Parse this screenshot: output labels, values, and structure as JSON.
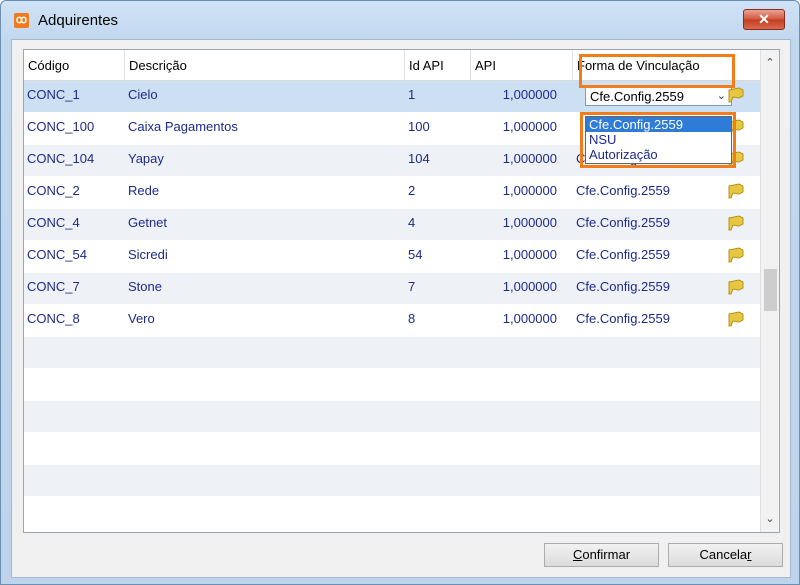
{
  "window": {
    "title": "Adquirentes",
    "close_label": "✕"
  },
  "columns": [
    "Código",
    "Descrição",
    "Id API",
    "API",
    "Forma de Vinculação"
  ],
  "rows": [
    {
      "codigo": "CONC_1",
      "descricao": "Cielo",
      "id_api": "1",
      "api": "1,000000",
      "forma": "Cfe.Config.2559"
    },
    {
      "codigo": "CONC_100",
      "descricao": "Caixa Pagamentos",
      "id_api": "100",
      "api": "1,000000",
      "forma": ""
    },
    {
      "codigo": "CONC_104",
      "descricao": "Yapay",
      "id_api": "104",
      "api": "1,000000",
      "forma": "Cfe.Config.2559"
    },
    {
      "codigo": "CONC_2",
      "descricao": "Rede",
      "id_api": "2",
      "api": "1,000000",
      "forma": "Cfe.Config.2559"
    },
    {
      "codigo": "CONC_4",
      "descricao": "Getnet",
      "id_api": "4",
      "api": "1,000000",
      "forma": "Cfe.Config.2559"
    },
    {
      "codigo": "CONC_54",
      "descricao": "Sicredi",
      "id_api": "54",
      "api": "1,000000",
      "forma": "Cfe.Config.2559"
    },
    {
      "codigo": "CONC_7",
      "descricao": "Stone",
      "id_api": "7",
      "api": "1,000000",
      "forma": "Cfe.Config.2559"
    },
    {
      "codigo": "CONC_8",
      "descricao": "Vero",
      "id_api": "8",
      "api": "1,000000",
      "forma": "Cfe.Config.2559"
    }
  ],
  "combo": {
    "value": "Cfe.Config.2559",
    "options": [
      "Cfe.Config.2559",
      "NSU",
      "Autorização"
    ]
  },
  "buttons": {
    "confirm_prefix": "C",
    "confirm_rest": "onfirmar",
    "cancel_prefix": "Cancela",
    "cancel_underline": "r"
  },
  "icons": {
    "row_action": "flag-icon",
    "app": "app-logo-icon"
  },
  "colors": {
    "selected_row": "#cddff2",
    "highlight": "#f07c1a",
    "text_blue": "#1d2a8a"
  }
}
